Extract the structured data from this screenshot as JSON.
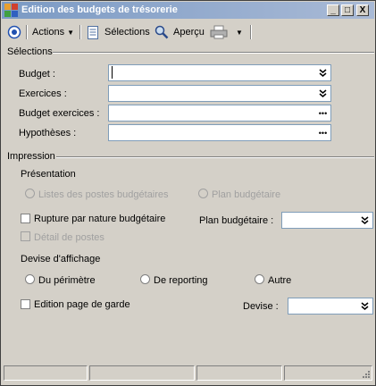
{
  "window": {
    "title": "Edition des budgets de trésorerie",
    "minimize": "_",
    "maximize": "□",
    "close": "X"
  },
  "toolbar": {
    "actions_label": "Actions",
    "selections_label": "Sélections",
    "apercu_label": "Aperçu"
  },
  "selections": {
    "section_title": "Sélections",
    "budget_label": "Budget :",
    "budget_value": "",
    "exercices_label": "Exercices :",
    "exercices_value": "",
    "budget_exercices_label": "Budget exercices :",
    "budget_exercices_value": "",
    "hypotheses_label": "Hypothèses :",
    "hypotheses_value": ""
  },
  "impression": {
    "section_title": "Impression",
    "presentation_title": "Présentation",
    "radio_listes": "Listes des postes budgétaires",
    "radio_plan": "Plan budgétaire",
    "check_rupture": "Rupture par nature budgétaire",
    "plan_budgetaire_label": "Plan budgétaire :",
    "plan_budgetaire_value": "",
    "check_detail": "Détail de postes",
    "devise_affichage_title": "Devise d'affichage",
    "radio_perimetre": "Du périmètre",
    "radio_reporting": "De reporting",
    "radio_autre": "Autre",
    "check_edition": "Edition page de garde",
    "devise_label": "Devise :",
    "devise_value": ""
  },
  "colors": {
    "titlebar_start": "#7b9ac4",
    "titlebar_end": "#a9bad6",
    "window_bg": "#d4d0c8",
    "field_border": "#7f9db9"
  }
}
